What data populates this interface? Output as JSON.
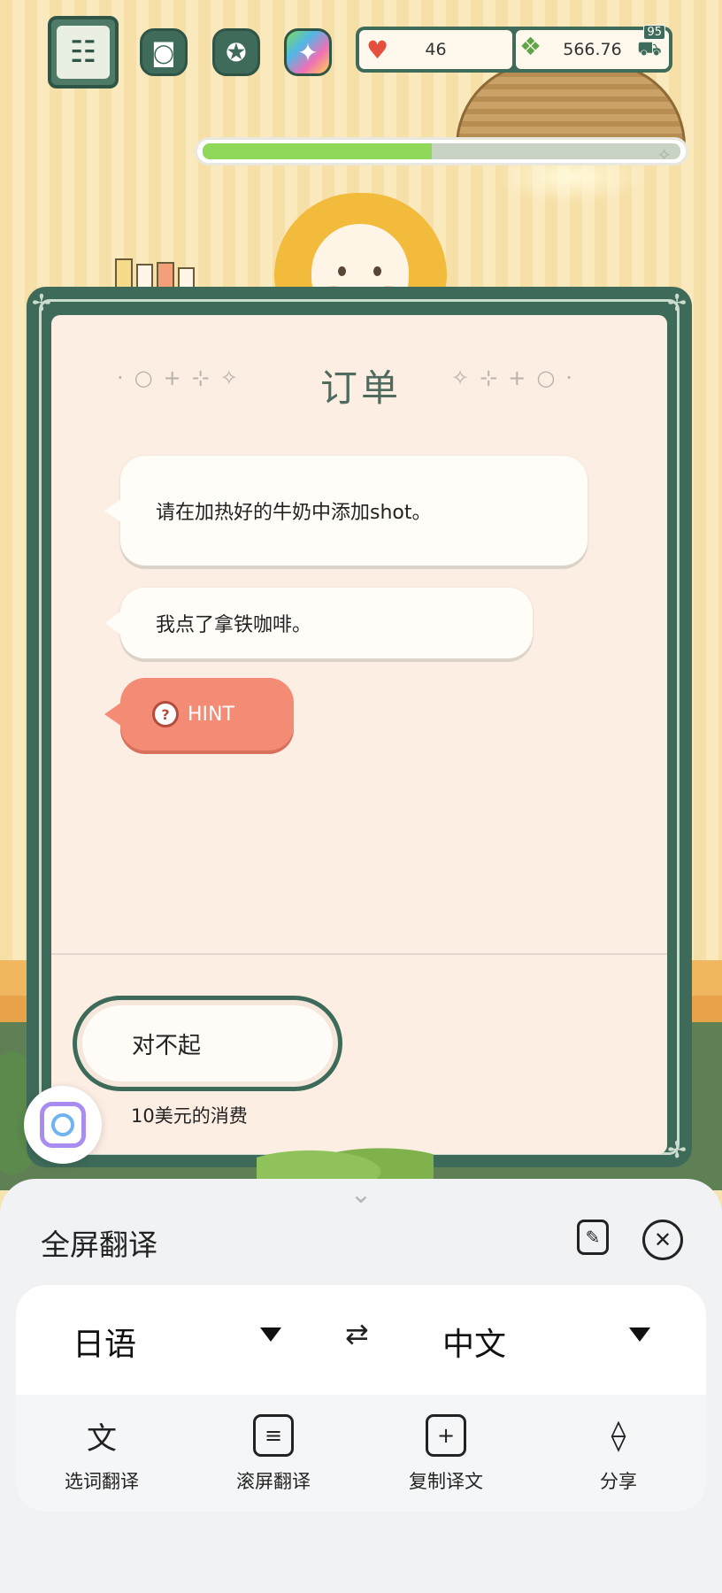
{
  "hud": {
    "hearts": "46",
    "cash": "566.76",
    "basket_badge": "95",
    "progress_fraction": 0.48,
    "icons": [
      "menu-icon",
      "camera-icon",
      "award-icon",
      "sparkle-icon"
    ]
  },
  "order": {
    "title": "订单",
    "bubbles": [
      "请在加热好的牛奶中添加shot。",
      "我点了拿铁咖啡。"
    ],
    "hint_label": "HINT",
    "hint_icon_text": "?",
    "reply_option": "对不起",
    "reply_subtext": "10美元的消费"
  },
  "translate_panel": {
    "title": "全屏翻译",
    "source_lang": "日语",
    "target_lang": "中文",
    "tools": [
      {
        "label": "选词翻译",
        "icon": "select-word-translate-icon"
      },
      {
        "label": "滚屏翻译",
        "icon": "scroll-translate-icon"
      },
      {
        "label": "复制译文",
        "icon": "copy-translation-icon"
      },
      {
        "label": "分享",
        "icon": "share-icon"
      }
    ]
  },
  "colors": {
    "frame_green": "#3e6b59",
    "card_bg": "#fdeee4",
    "hint_coral": "#f38b75",
    "progress_green": "#8fd85a"
  }
}
